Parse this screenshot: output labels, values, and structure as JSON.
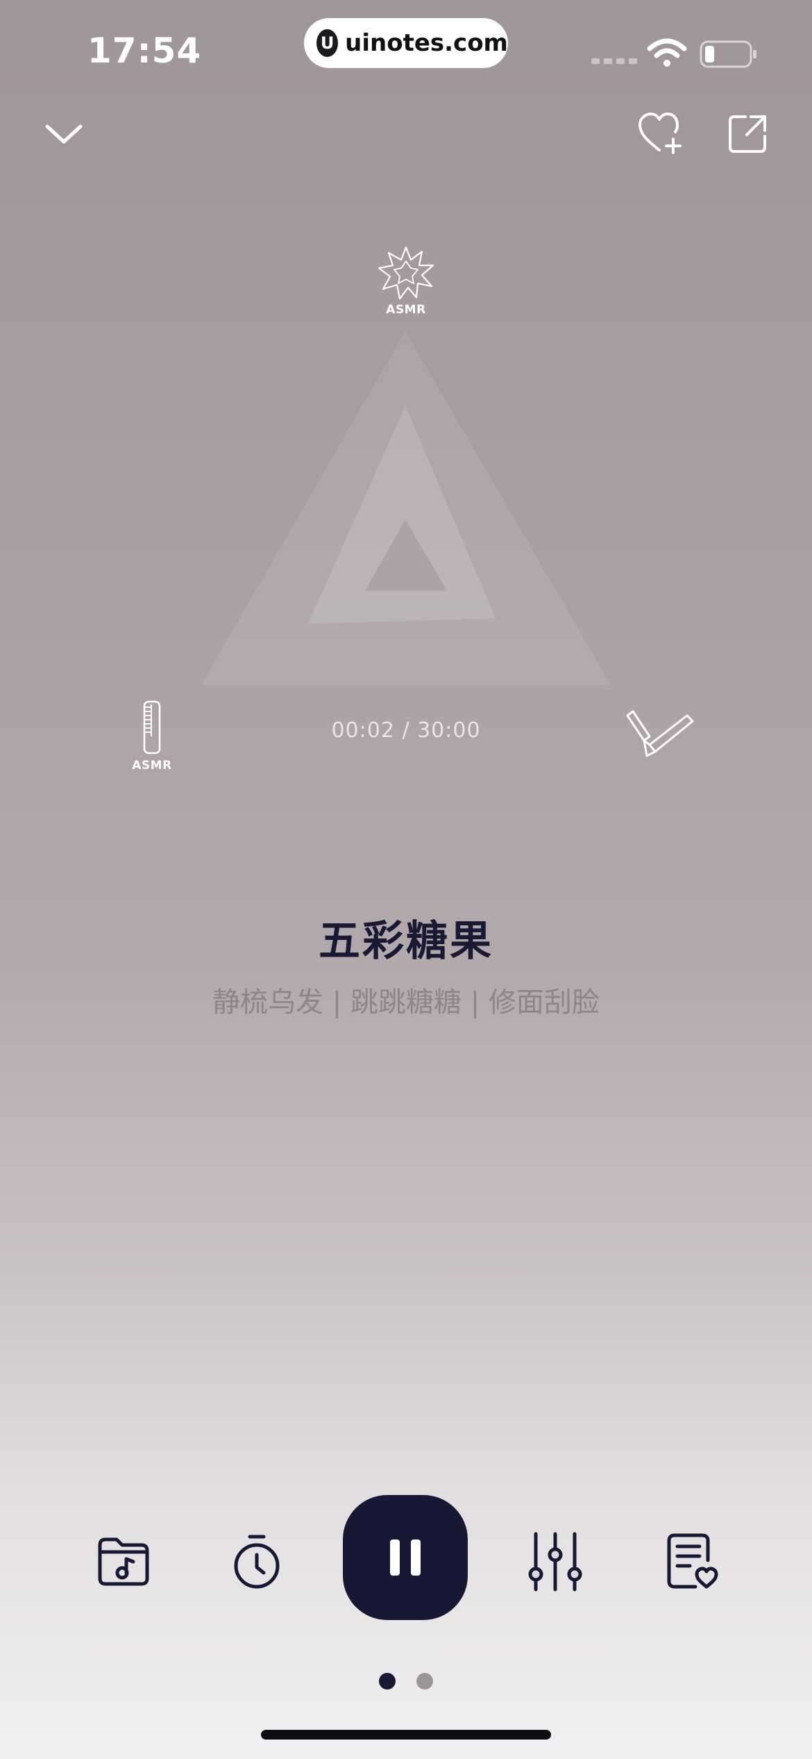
{
  "status_bar": {
    "time": "17:54",
    "badge_logo": "U",
    "badge_text": "uinotes.com",
    "wifi_icon": "wifi-icon",
    "battery_icon": "battery-icon"
  },
  "nav": {
    "collapse_icon": "chevron-down-icon",
    "favorite_icon": "heart-plus-icon",
    "share_icon": "share-icon"
  },
  "scene": {
    "sounds": [
      {
        "name": "sparkle",
        "label": "ASMR"
      },
      {
        "name": "comb",
        "label": "ASMR"
      },
      {
        "name": "razor",
        "label": ""
      }
    ],
    "timer": "00:02 / 30:00"
  },
  "track": {
    "title": "五彩糖果",
    "subtitle": "静梳乌发 | 跳跳糖糖 | 修面刮脸"
  },
  "controls": [
    {
      "name": "playlist",
      "icon": "music-folder-icon"
    },
    {
      "name": "sleep-timer",
      "icon": "stopwatch-icon"
    },
    {
      "name": "pause",
      "icon": "pause-icon"
    },
    {
      "name": "mixer",
      "icon": "sliders-icon"
    },
    {
      "name": "favorites-list",
      "icon": "document-heart-icon"
    }
  ],
  "pager": {
    "total": 2,
    "current": 1
  },
  "colors": {
    "accent": "#161834",
    "title": "#1a1933",
    "subtitle": "#8e8489",
    "dot_active": "#1a1933",
    "dot_inactive": "#9c9599"
  }
}
